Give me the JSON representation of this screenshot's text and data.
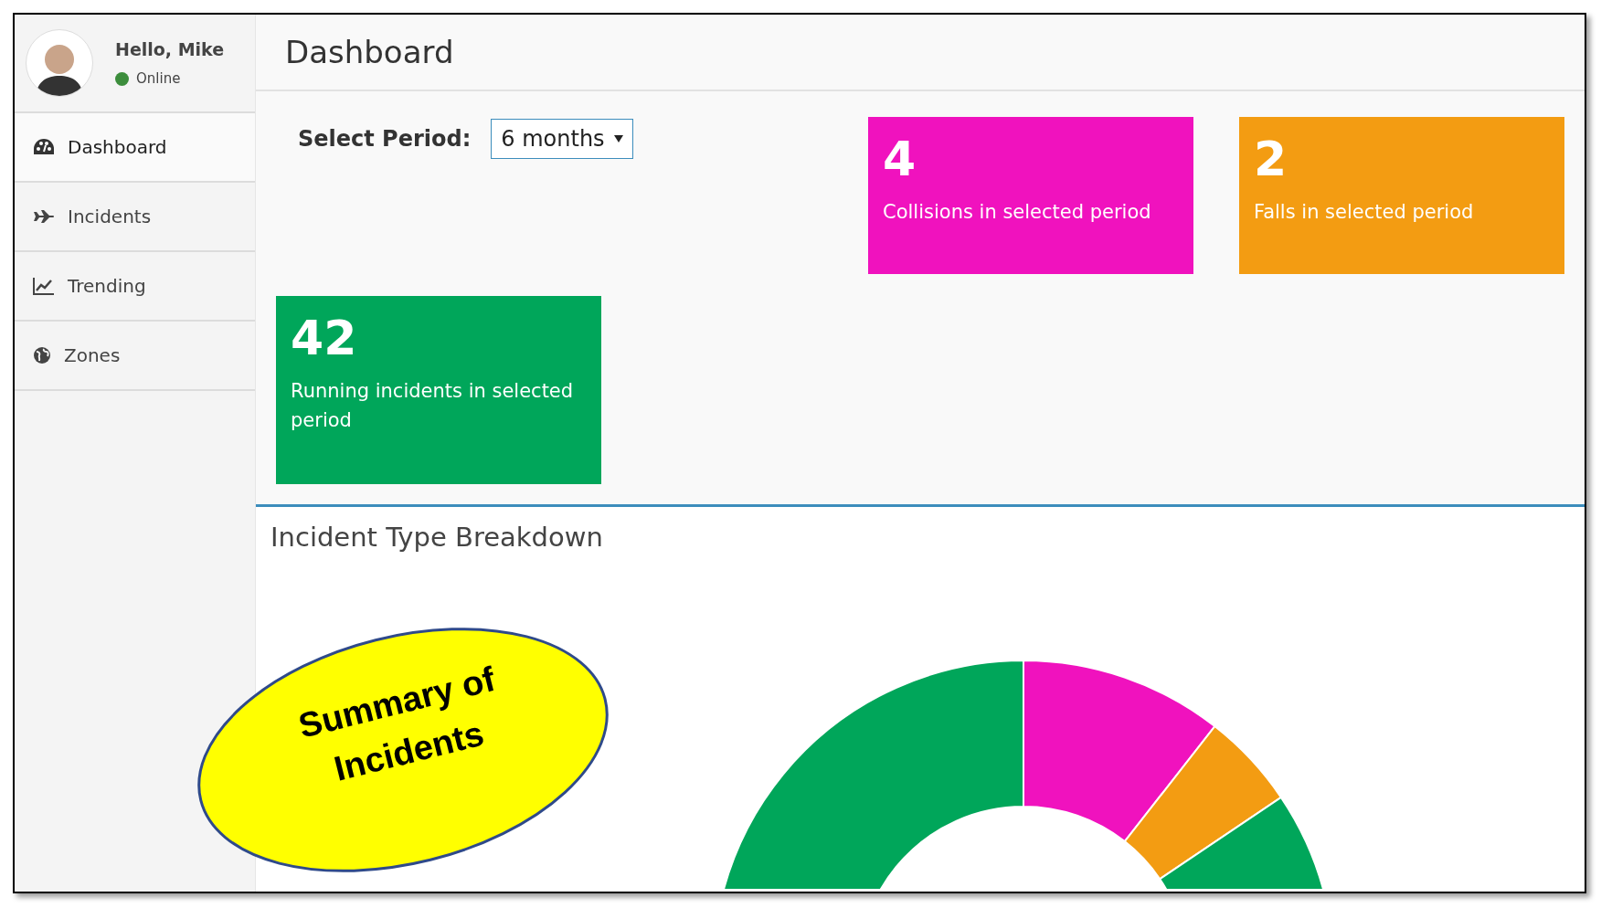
{
  "user": {
    "greeting": "Hello, Mike",
    "status": "Online",
    "online": true
  },
  "sidebar": {
    "items": [
      {
        "label": "Dashboard",
        "kind": "dashboard",
        "selected": true
      },
      {
        "label": "Incidents",
        "kind": "plane",
        "selected": false
      },
      {
        "label": "Trending",
        "kind": "chart",
        "selected": false
      },
      {
        "label": "Zones",
        "kind": "globe",
        "selected": false
      }
    ]
  },
  "page_title": "Dashboard",
  "period": {
    "label": "Select Period:",
    "value": "6 months"
  },
  "cards": [
    {
      "number": "4",
      "text": "Collisions in selected period",
      "color": "#f012be"
    },
    {
      "number": "2",
      "text": "Falls in selected period",
      "color": "#f39c12"
    },
    {
      "number": "42",
      "text": "Running incidents in selected period",
      "color": "#00a65a"
    }
  ],
  "breakdown": {
    "title": "Incident Type Breakdown"
  },
  "callout": {
    "text": "Summary of Incidents"
  }
}
